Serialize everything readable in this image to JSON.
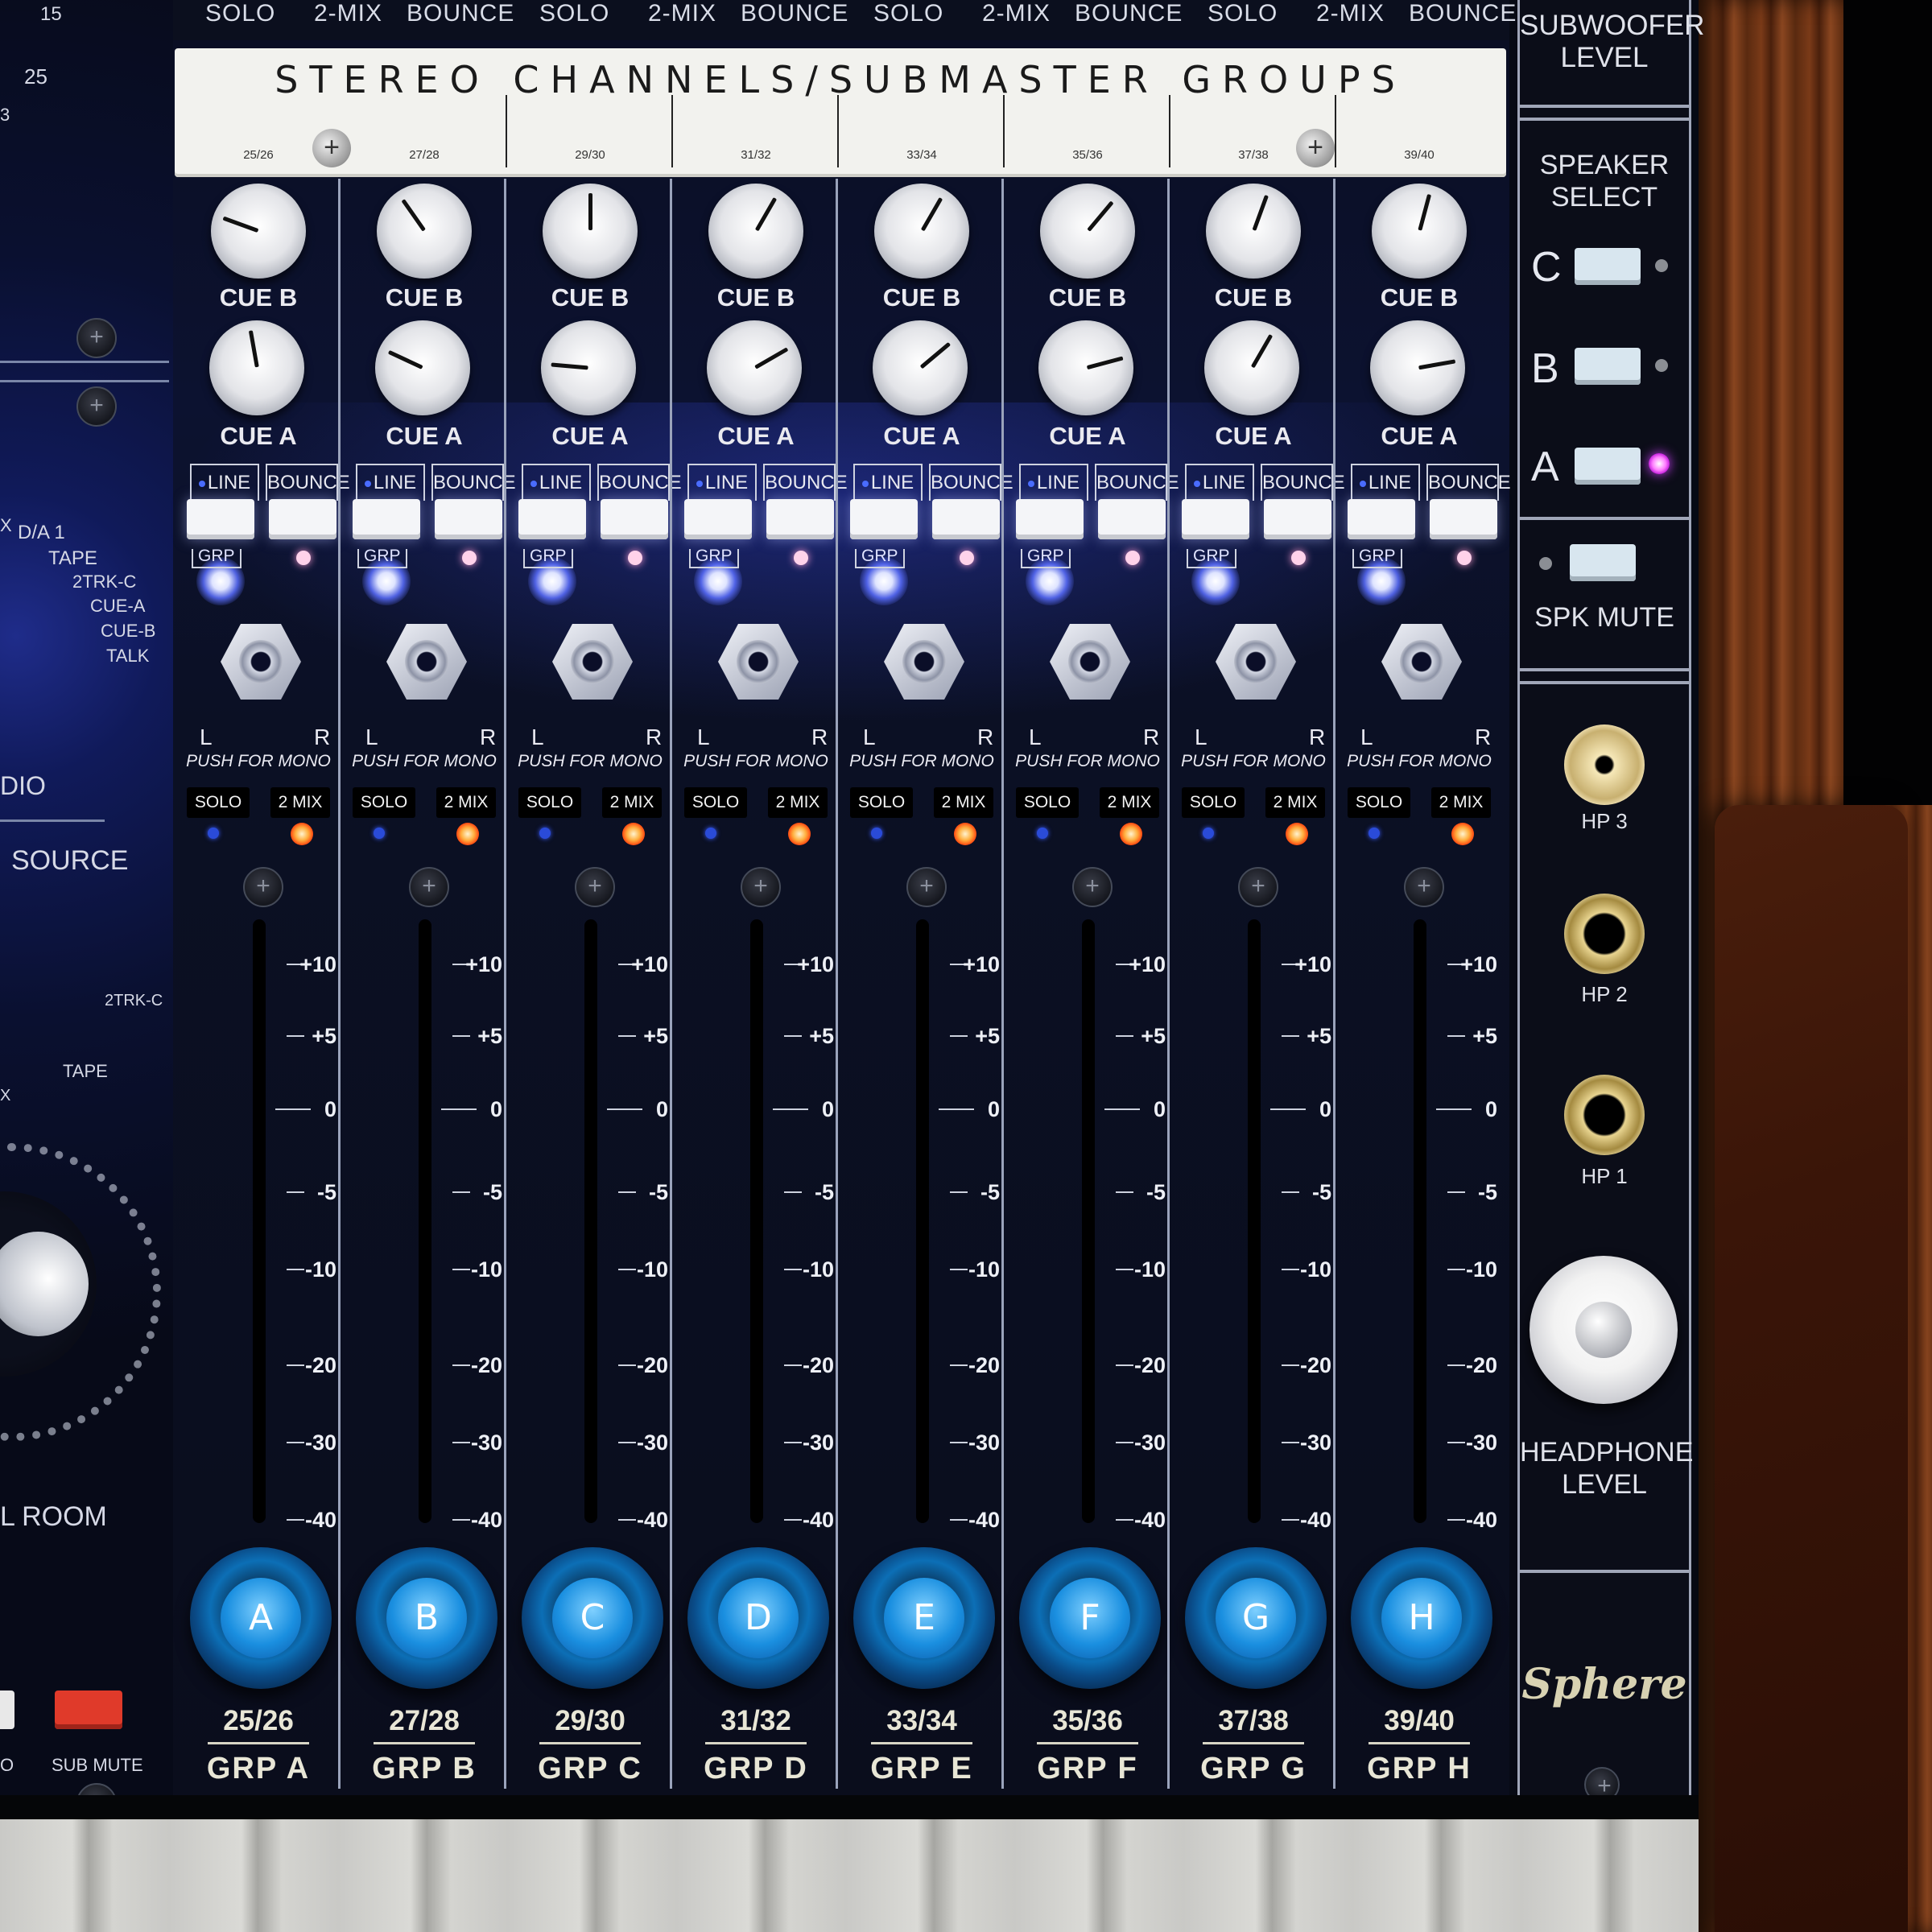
{
  "top_strip_legend": [
    "SOLO",
    "2-MIX",
    "BOUNCE",
    "SOLO",
    "2-MIX",
    "BOUNCE",
    "SOLO",
    "2-MIX",
    "BOUNCE",
    "SOLO",
    "2-MIX",
    "BOUNCE"
  ],
  "banner": {
    "title": "STEREO CHANNELS/SUBMASTER GROUPS",
    "channel_numbers": [
      "25/26",
      "27/28",
      "29/30",
      "31/32",
      "33/34",
      "35/36",
      "37/38",
      "39/40"
    ]
  },
  "strip_labels": {
    "cue_b": "CUE B",
    "cue_a": "CUE A",
    "line": "LINE",
    "bounce": "BOUNCE",
    "grp": "GRP",
    "left": "L",
    "right": "R",
    "push_for_mono": "PUSH FOR MONO",
    "solo": "SOLO",
    "two_mix": "2 MIX"
  },
  "fader_scale": [
    "+10",
    "+5",
    "0",
    "-5",
    "-10",
    "-20",
    "-30",
    "-40"
  ],
  "strips": [
    {
      "letter": "A",
      "channels": "25/26",
      "group": "GRP A",
      "cue_b_angle": -70,
      "cue_a_angle": -10
    },
    {
      "letter": "B",
      "channels": "27/28",
      "group": "GRP B",
      "cue_b_angle": -35,
      "cue_a_angle": -65
    },
    {
      "letter": "C",
      "channels": "29/30",
      "group": "GRP C",
      "cue_b_angle": 0,
      "cue_a_angle": -85
    },
    {
      "letter": "D",
      "channels": "31/32",
      "group": "GRP D",
      "cue_b_angle": 30,
      "cue_a_angle": 60
    },
    {
      "letter": "E",
      "channels": "33/34",
      "group": "GRP E",
      "cue_b_angle": 30,
      "cue_a_angle": 50
    },
    {
      "letter": "F",
      "channels": "35/36",
      "group": "GRP F",
      "cue_b_angle": 40,
      "cue_a_angle": 75
    },
    {
      "letter": "G",
      "channels": "37/38",
      "group": "GRP G",
      "cue_b_angle": 20,
      "cue_a_angle": 30
    },
    {
      "letter": "H",
      "channels": "39/40",
      "group": "GRP H",
      "cue_b_angle": 15,
      "cue_a_angle": 80
    }
  ],
  "right_panel": {
    "subwoofer_level": "SUBWOOFER LEVEL",
    "speaker_select": "SPEAKER SELECT",
    "speakers": [
      {
        "letter": "C",
        "led_on": false
      },
      {
        "letter": "B",
        "led_on": false
      },
      {
        "letter": "A",
        "led_on": true
      }
    ],
    "spk_mute": "SPK MUTE",
    "hp3": "HP 3",
    "hp2": "HP 2",
    "hp1": "HP 1",
    "headphone_level": "HEADPHONE LEVEL",
    "logo": "Sphere"
  },
  "left_panel": {
    "source_list": [
      "D/A 1",
      "TAPE",
      "2TRK-C",
      "CUE-A",
      "CUE-B",
      "TALK"
    ],
    "source_prefix": "X",
    "dio": "DIO",
    "source": "SOURCE",
    "tape_2trk_c": "2TRK-C",
    "tape": "TAPE",
    "x_label": "X",
    "room": "L ROOM",
    "sub_mute": "SUB MUTE",
    "o_label": "O",
    "top_numbers": [
      "15",
      "25",
      "3"
    ]
  }
}
